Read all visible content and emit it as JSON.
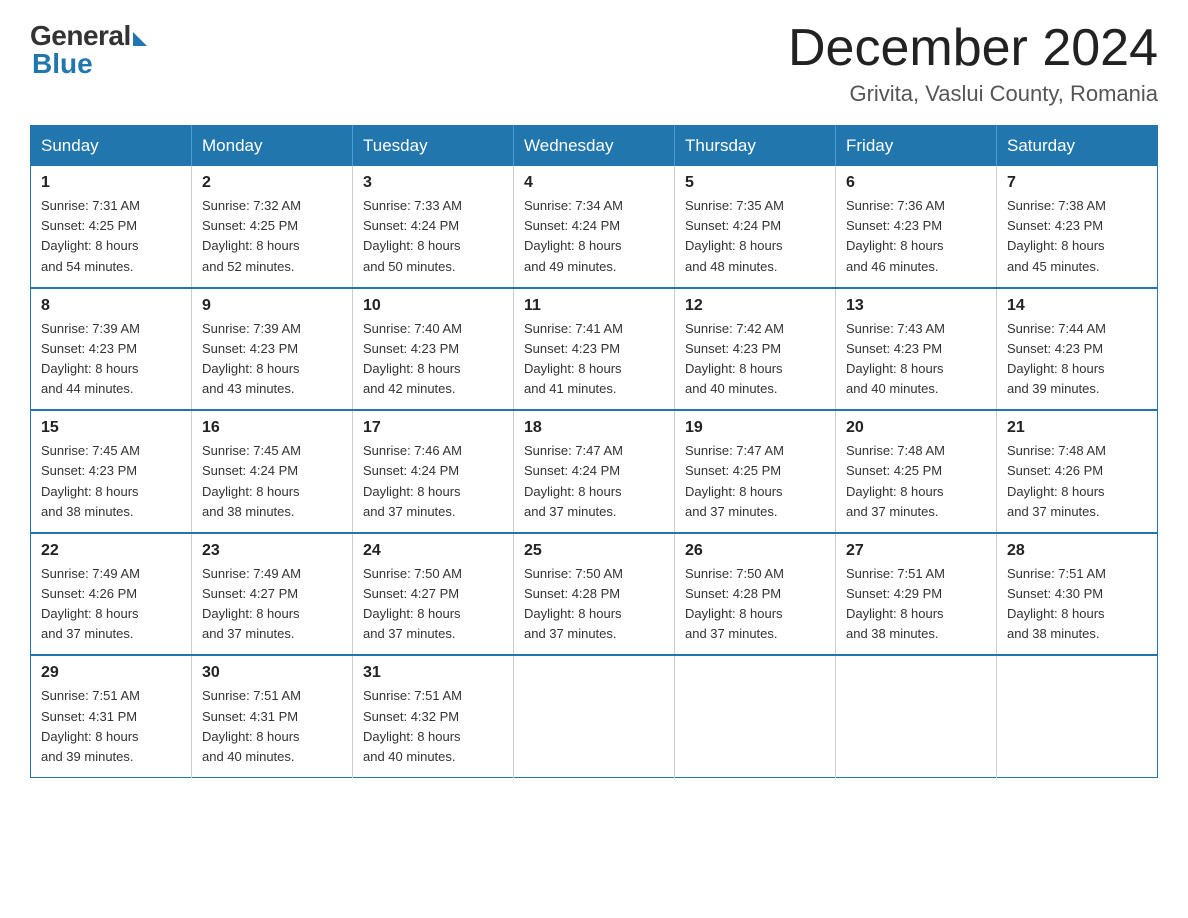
{
  "logo": {
    "general": "General",
    "blue": "Blue"
  },
  "header": {
    "month_year": "December 2024",
    "location": "Grivita, Vaslui County, Romania"
  },
  "weekdays": [
    "Sunday",
    "Monday",
    "Tuesday",
    "Wednesday",
    "Thursday",
    "Friday",
    "Saturday"
  ],
  "weeks": [
    [
      {
        "day": "1",
        "sunrise": "7:31 AM",
        "sunset": "4:25 PM",
        "daylight": "8 hours and 54 minutes."
      },
      {
        "day": "2",
        "sunrise": "7:32 AM",
        "sunset": "4:25 PM",
        "daylight": "8 hours and 52 minutes."
      },
      {
        "day": "3",
        "sunrise": "7:33 AM",
        "sunset": "4:24 PM",
        "daylight": "8 hours and 50 minutes."
      },
      {
        "day": "4",
        "sunrise": "7:34 AM",
        "sunset": "4:24 PM",
        "daylight": "8 hours and 49 minutes."
      },
      {
        "day": "5",
        "sunrise": "7:35 AM",
        "sunset": "4:24 PM",
        "daylight": "8 hours and 48 minutes."
      },
      {
        "day": "6",
        "sunrise": "7:36 AM",
        "sunset": "4:23 PM",
        "daylight": "8 hours and 46 minutes."
      },
      {
        "day": "7",
        "sunrise": "7:38 AM",
        "sunset": "4:23 PM",
        "daylight": "8 hours and 45 minutes."
      }
    ],
    [
      {
        "day": "8",
        "sunrise": "7:39 AM",
        "sunset": "4:23 PM",
        "daylight": "8 hours and 44 minutes."
      },
      {
        "day": "9",
        "sunrise": "7:39 AM",
        "sunset": "4:23 PM",
        "daylight": "8 hours and 43 minutes."
      },
      {
        "day": "10",
        "sunrise": "7:40 AM",
        "sunset": "4:23 PM",
        "daylight": "8 hours and 42 minutes."
      },
      {
        "day": "11",
        "sunrise": "7:41 AM",
        "sunset": "4:23 PM",
        "daylight": "8 hours and 41 minutes."
      },
      {
        "day": "12",
        "sunrise": "7:42 AM",
        "sunset": "4:23 PM",
        "daylight": "8 hours and 40 minutes."
      },
      {
        "day": "13",
        "sunrise": "7:43 AM",
        "sunset": "4:23 PM",
        "daylight": "8 hours and 40 minutes."
      },
      {
        "day": "14",
        "sunrise": "7:44 AM",
        "sunset": "4:23 PM",
        "daylight": "8 hours and 39 minutes."
      }
    ],
    [
      {
        "day": "15",
        "sunrise": "7:45 AM",
        "sunset": "4:23 PM",
        "daylight": "8 hours and 38 minutes."
      },
      {
        "day": "16",
        "sunrise": "7:45 AM",
        "sunset": "4:24 PM",
        "daylight": "8 hours and 38 minutes."
      },
      {
        "day": "17",
        "sunrise": "7:46 AM",
        "sunset": "4:24 PM",
        "daylight": "8 hours and 37 minutes."
      },
      {
        "day": "18",
        "sunrise": "7:47 AM",
        "sunset": "4:24 PM",
        "daylight": "8 hours and 37 minutes."
      },
      {
        "day": "19",
        "sunrise": "7:47 AM",
        "sunset": "4:25 PM",
        "daylight": "8 hours and 37 minutes."
      },
      {
        "day": "20",
        "sunrise": "7:48 AM",
        "sunset": "4:25 PM",
        "daylight": "8 hours and 37 minutes."
      },
      {
        "day": "21",
        "sunrise": "7:48 AM",
        "sunset": "4:26 PM",
        "daylight": "8 hours and 37 minutes."
      }
    ],
    [
      {
        "day": "22",
        "sunrise": "7:49 AM",
        "sunset": "4:26 PM",
        "daylight": "8 hours and 37 minutes."
      },
      {
        "day": "23",
        "sunrise": "7:49 AM",
        "sunset": "4:27 PM",
        "daylight": "8 hours and 37 minutes."
      },
      {
        "day": "24",
        "sunrise": "7:50 AM",
        "sunset": "4:27 PM",
        "daylight": "8 hours and 37 minutes."
      },
      {
        "day": "25",
        "sunrise": "7:50 AM",
        "sunset": "4:28 PM",
        "daylight": "8 hours and 37 minutes."
      },
      {
        "day": "26",
        "sunrise": "7:50 AM",
        "sunset": "4:28 PM",
        "daylight": "8 hours and 37 minutes."
      },
      {
        "day": "27",
        "sunrise": "7:51 AM",
        "sunset": "4:29 PM",
        "daylight": "8 hours and 38 minutes."
      },
      {
        "day": "28",
        "sunrise": "7:51 AM",
        "sunset": "4:30 PM",
        "daylight": "8 hours and 38 minutes."
      }
    ],
    [
      {
        "day": "29",
        "sunrise": "7:51 AM",
        "sunset": "4:31 PM",
        "daylight": "8 hours and 39 minutes."
      },
      {
        "day": "30",
        "sunrise": "7:51 AM",
        "sunset": "4:31 PM",
        "daylight": "8 hours and 40 minutes."
      },
      {
        "day": "31",
        "sunrise": "7:51 AM",
        "sunset": "4:32 PM",
        "daylight": "8 hours and 40 minutes."
      },
      null,
      null,
      null,
      null
    ]
  ],
  "labels": {
    "sunrise": "Sunrise:",
    "sunset": "Sunset:",
    "daylight": "Daylight:"
  }
}
